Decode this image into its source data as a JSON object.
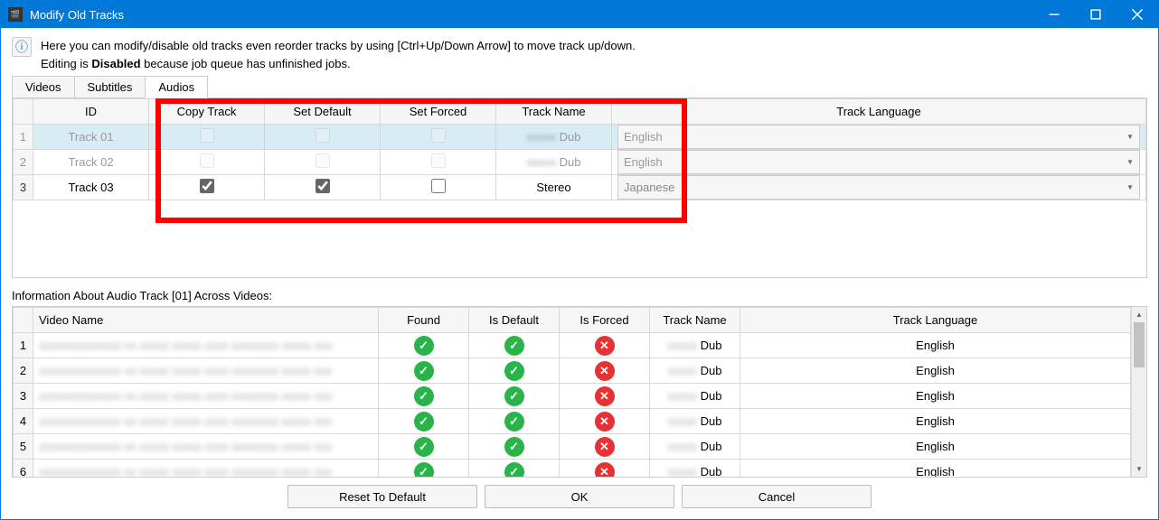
{
  "window": {
    "title": "Modify Old Tracks"
  },
  "info": {
    "line1": "Here you can modify/disable old tracks even reorder tracks by using [Ctrl+Up/Down Arrow] to move track up/down.",
    "line2_prefix": "Editing is ",
    "line2_bold": "Disabled",
    "line2_suffix": " because job queue has unfinished jobs."
  },
  "tabs": {
    "videos": "Videos",
    "subtitles": "Subtitles",
    "audios": "Audios",
    "active": "audios"
  },
  "tracks": {
    "headers": {
      "id": "ID",
      "copy": "Copy Track",
      "set_default": "Set Default",
      "set_forced": "Set Forced",
      "track_name": "Track Name",
      "track_language": "Track Language"
    },
    "rows": [
      {
        "num": "1",
        "id": "Track 01",
        "copy": false,
        "def": false,
        "forced": false,
        "name_blur": "xxxxx",
        "name": "Dub",
        "lang": "English",
        "disabled": true,
        "selected": true
      },
      {
        "num": "2",
        "id": "Track 02",
        "copy": false,
        "def": false,
        "forced": false,
        "name_blur": "xxxxx",
        "name": "Dub",
        "lang": "English",
        "disabled": true,
        "selected": false
      },
      {
        "num": "3",
        "id": "Track 03",
        "copy": true,
        "def": true,
        "forced": false,
        "name_blur": "",
        "name": "Stereo",
        "lang": "Japanese",
        "disabled": false,
        "selected": false
      }
    ]
  },
  "info_section_label": "Information About Audio Track [01] Across Videos:",
  "info_table": {
    "headers": {
      "video_name": "Video Name",
      "found": "Found",
      "is_default": "Is Default",
      "is_forced": "Is Forced",
      "track_name": "Track Name",
      "track_language": "Track Language"
    },
    "rows": [
      {
        "num": "1",
        "vname": "xxxxxxxxxxxxxx   xx  xxxxx xxxxx  xxxx xxxxxxxx xxxxx xxx",
        "found": true,
        "def": true,
        "forced": false,
        "tname_blur": "xxxxx",
        "tname": "Dub",
        "lang": "English"
      },
      {
        "num": "2",
        "vname": "xxxxxxxxxxxxxx   xx  xxxxx xxxxx  xxxx xxxxxxxx xxxxx xxx",
        "found": true,
        "def": true,
        "forced": false,
        "tname_blur": "xxxxx",
        "tname": "Dub",
        "lang": "English"
      },
      {
        "num": "3",
        "vname": "xxxxxxxxxxxxxx   xx  xxxxx xxxxx  xxxx xxxxxxxx xxxxx xxx",
        "found": true,
        "def": true,
        "forced": false,
        "tname_blur": "xxxxx",
        "tname": "Dub",
        "lang": "English"
      },
      {
        "num": "4",
        "vname": "xxxxxxxxxxxxxx   xx  xxxxx xxxxx  xxxx xxxxxxxx xxxxx xxx",
        "found": true,
        "def": true,
        "forced": false,
        "tname_blur": "xxxxx",
        "tname": "Dub",
        "lang": "English"
      },
      {
        "num": "5",
        "vname": "xxxxxxxxxxxxxx   xx  xxxxx xxxxx  xxxx xxxxxxxx xxxxx xxx",
        "found": true,
        "def": true,
        "forced": false,
        "tname_blur": "xxxxx",
        "tname": "Dub",
        "lang": "English"
      },
      {
        "num": "6",
        "vname": "xxxxxxxxxxxxxx   xx  xxxxx xxxxx  xxxx xxxxxxxx xxxxx xxx",
        "found": true,
        "def": true,
        "forced": false,
        "tname_blur": "xxxxx",
        "tname": "Dub",
        "lang": "English"
      }
    ]
  },
  "buttons": {
    "reset": "Reset To Default",
    "ok": "OK",
    "cancel": "Cancel"
  }
}
